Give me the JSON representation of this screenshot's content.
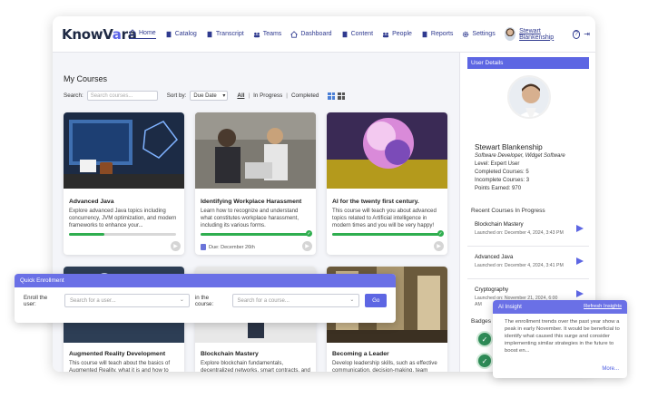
{
  "brand": {
    "name_prefix": "KnowV",
    "name_mark": "a",
    "name_suffix": "ra"
  },
  "nav_left": [
    {
      "label": "Home",
      "icon": "home-icon"
    },
    {
      "label": "Catalog",
      "icon": "catalog-icon"
    },
    {
      "label": "Transcript",
      "icon": "transcript-icon"
    },
    {
      "label": "Teams",
      "icon": "teams-icon"
    }
  ],
  "nav_right": [
    {
      "label": "Dashboard",
      "icon": "dashboard-icon"
    },
    {
      "label": "Content",
      "icon": "content-icon"
    },
    {
      "label": "People",
      "icon": "people-icon"
    },
    {
      "label": "Reports",
      "icon": "reports-icon"
    },
    {
      "label": "Settings",
      "icon": "gear-icon"
    }
  ],
  "user_menu": {
    "name": "Stewart Blankenship",
    "help": "?",
    "logout": "⇥"
  },
  "my_courses": {
    "title": "My Courses",
    "search_label": "Search:",
    "search_placeholder": "Search courses...",
    "sort_label": "Sort by:",
    "sort_value": "Due Date",
    "filters": [
      "All",
      "In Progress",
      "Completed"
    ],
    "filter_sep": "|"
  },
  "courses": [
    {
      "title": "Advanced Java",
      "desc": "Explore advanced Java topics including concurrency, JVM optimization, and modern frameworks to enhance your...",
      "progress": 0.33,
      "completed": false,
      "due": ""
    },
    {
      "title": "Identifying Workplace Harassment",
      "desc": "Learn how to recognize and understand what constitutes workplace harassment, including its various forms.",
      "progress": 1.0,
      "completed": true,
      "due": "Due: December 26th"
    },
    {
      "title": "AI for the twenty first century.",
      "desc": "This course will teach you about advanced topics related to Artificial intelligence in modern times and you will be very happy!",
      "progress": 1.0,
      "completed": true,
      "due": ""
    },
    {
      "title": "Augmented Reality Development",
      "desc": "This course will teach about the basics of Augmented Reality, what it is and how to take advantage of it in your training."
    },
    {
      "title": "Blockchain Mastery",
      "desc": "Explore blockchain fundamentals, decentralized networks, smart contracts, and real-world applications in this..."
    },
    {
      "title": "Becoming a Leader",
      "desc": "Develop leadership skills, such as effective communication, decision-making, team management, and strategic thinking."
    }
  ],
  "quick_enroll": {
    "title": "Quick Enrollment",
    "user_label": "Enroll the user:",
    "user_placeholder": "Search for a user...",
    "course_label": "in the course:",
    "course_placeholder": "Search for a course...",
    "go_label": "Go"
  },
  "user_details": {
    "header": "User Details",
    "name": "Stewart Blankenship",
    "title": "Software Developer, Widget Software",
    "level": "Level: Expert User",
    "completed": "Completed Courses: 5",
    "incomplete": "Incomplete Courses: 3",
    "points": "Points Earned: 970"
  },
  "recent": {
    "title": "Recent Courses In Progress",
    "items": [
      {
        "title": "Blockchain Mastery",
        "meta": "Launched on: December 4, 2024, 3:43 PM"
      },
      {
        "title": "Advanced Java",
        "meta": "Launched on: December 4, 2024, 3:41 PM"
      },
      {
        "title": "Cryptography",
        "meta": "Launched on: November 21, 2024, 6:00 AM"
      }
    ]
  },
  "badges": {
    "label": "Badges"
  },
  "ai_insight": {
    "title": "AI Insight",
    "refresh": "Refresh Insights",
    "body": "The enrollment trends over the past year show a peak in early November. It would be beneficial to identify what caused this surge and consider implementing similar strategies in the future to boost en...",
    "more": "More..."
  },
  "colors": {
    "accent": "#5d66e3",
    "success": "#2fae4f",
    "nav": "#2f3a8f"
  }
}
